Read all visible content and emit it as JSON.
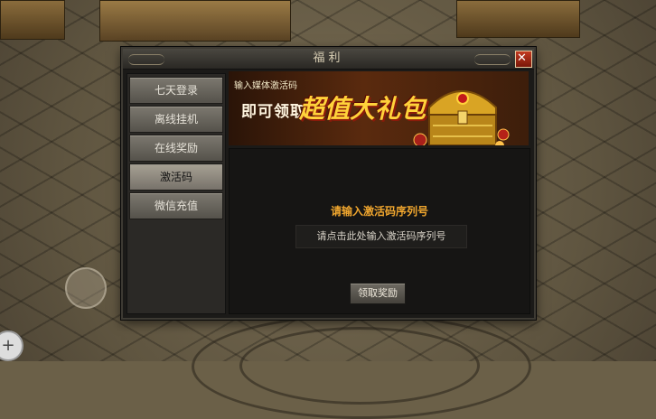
{
  "dialog": {
    "title": "福利",
    "close_label": "✕"
  },
  "sidebar": {
    "items": [
      {
        "label": "七天登录"
      },
      {
        "label": "离线挂机"
      },
      {
        "label": "在线奖励"
      },
      {
        "label": "激活码",
        "active": true
      },
      {
        "label": "微信充值"
      }
    ]
  },
  "banner": {
    "line1": "输入媒体激活码",
    "line2": "即可领取",
    "line3": "超值大礼包"
  },
  "content": {
    "prompt_title": "请输入激活码序列号",
    "input_placeholder": "请点击此处输入激活码序列号",
    "claim_label": "领取奖励"
  },
  "hud": {
    "corner_button": "+"
  },
  "icons": [
    "close-icon",
    "treasure-chest-icon",
    "joystick-icon",
    "add-icon"
  ],
  "colors": {
    "accent_orange": "#f0a62e",
    "banner_gold": "#ffd23a",
    "close_red": "#c23a22"
  }
}
